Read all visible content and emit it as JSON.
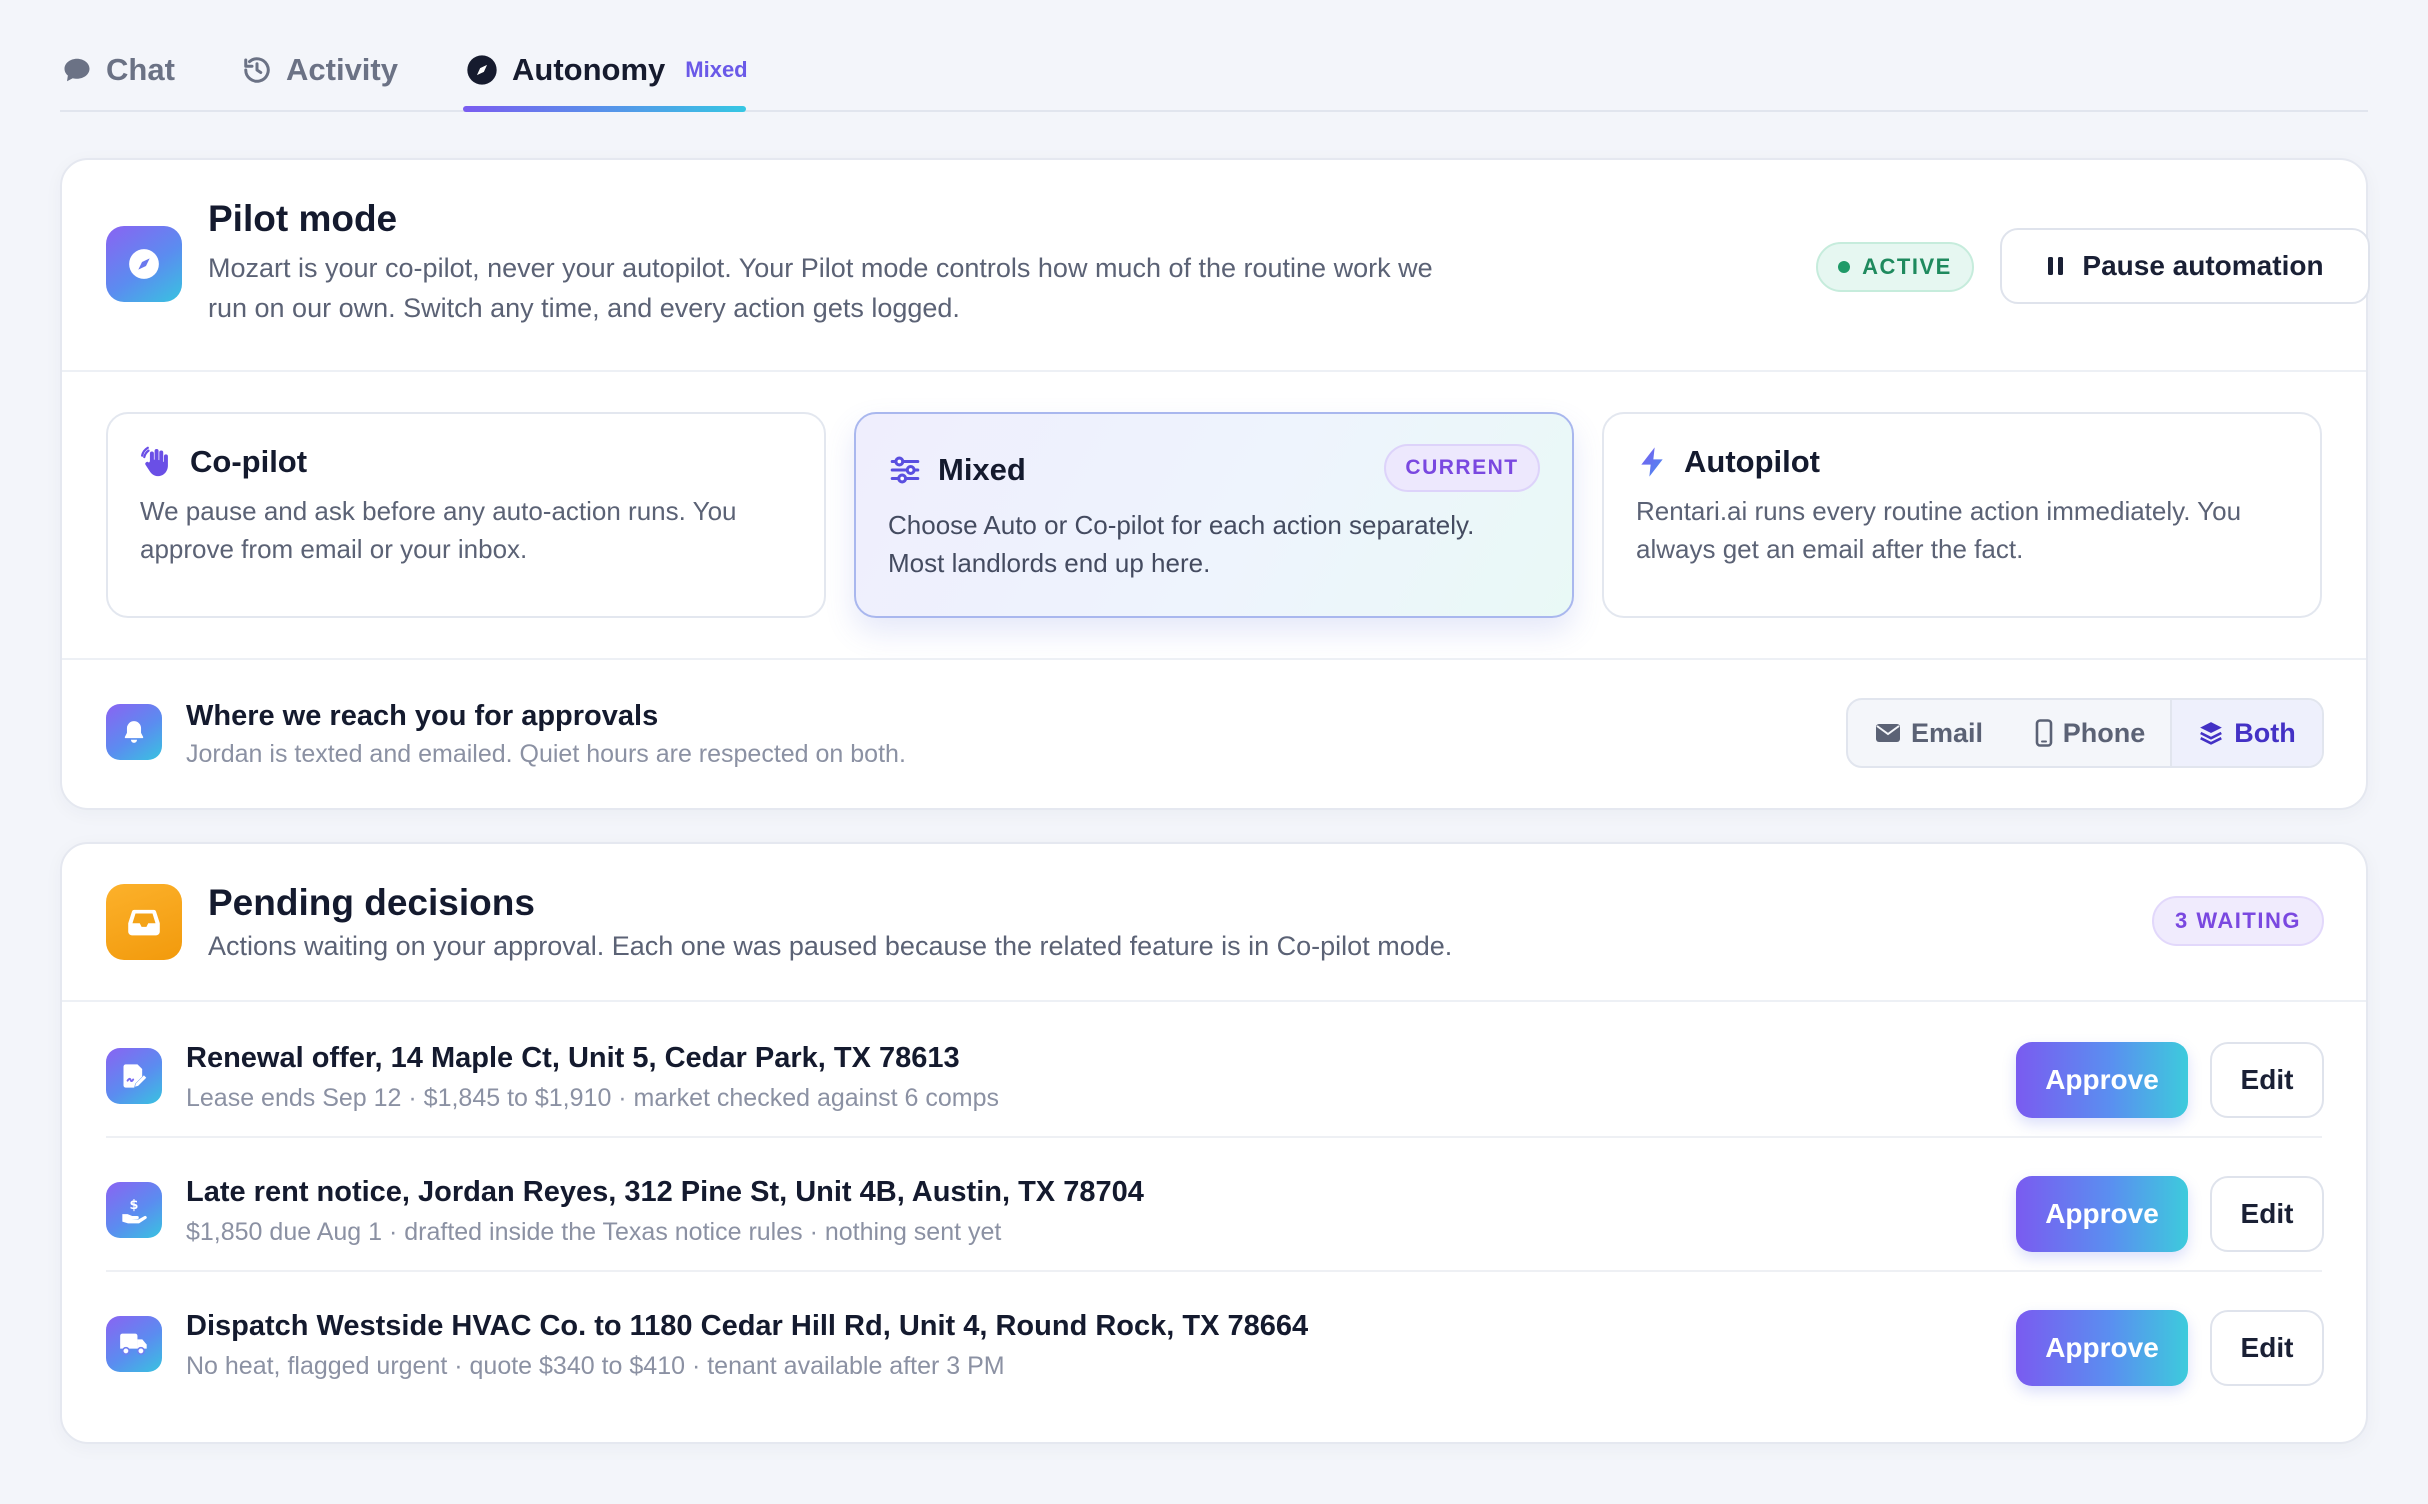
{
  "tabs": {
    "chat": "Chat",
    "activity": "Activity",
    "autonomy": "Autonomy",
    "autonomy_badge": "Mixed"
  },
  "pilot": {
    "title": "Pilot mode",
    "description_line1": "Mozart is your co-pilot, never your autopilot. Your Pilot mode controls how much of the routine work we",
    "description_line2": "run on our own. Switch any time, and every action gets logged.",
    "status": "ACTIVE",
    "pause_label": "Pause automation",
    "modes": {
      "copilot": {
        "title": "Co-pilot",
        "line1": "We pause and ask before any auto-action runs. You",
        "line2": "approve from email or your inbox."
      },
      "mixed": {
        "title": "Mixed",
        "badge": "CURRENT",
        "line1": "Choose Auto or Co-pilot for each action separately.",
        "line2": "Most landlords end up here."
      },
      "autopilot": {
        "title": "Autopilot",
        "line1": "Rentari.ai runs every routine action immediately. You",
        "line2": "always get an email after the fact."
      }
    },
    "approvals": {
      "title": "Where we reach you for approvals",
      "subtitle": "Jordan is texted and emailed. Quiet hours are respected on both.",
      "options": {
        "email": "Email",
        "phone": "Phone",
        "both": "Both"
      },
      "selected": "Both"
    }
  },
  "pending": {
    "title": "Pending decisions",
    "description": "Actions waiting on your approval. Each one was paused because the related feature is in Co-pilot mode.",
    "badge": "3 WAITING",
    "approve_label": "Approve",
    "edit_label": "Edit",
    "items": [
      {
        "icon": "document-signature-icon",
        "title": "Renewal offer, 14 Maple Ct, Unit 5, Cedar Park, TX 78613",
        "subtitle": "Lease ends Sep 12 · $1,845 to $1,910 · market checked against 6 comps"
      },
      {
        "icon": "hand-dollar-icon",
        "title": "Late rent notice, Jordan Reyes, 312 Pine St, Unit 4B, Austin, TX 78704",
        "subtitle": "$1,850 due Aug 1 · drafted inside the Texas notice rules · nothing sent yet"
      },
      {
        "icon": "truck-icon",
        "title": "Dispatch Westside HVAC Co. to 1180 Cedar Hill Rd, Unit 4, Round Rock, TX 78664",
        "subtitle": "No heat, flagged urgent · quote $340 to $410 · tenant available after 3 PM"
      }
    ]
  },
  "colors": {
    "accent_purple": "#7a5bf0",
    "accent_cyan": "#3dcbdc",
    "active_green": "#1f8a5e",
    "pending_orange": "#f7a81c"
  }
}
